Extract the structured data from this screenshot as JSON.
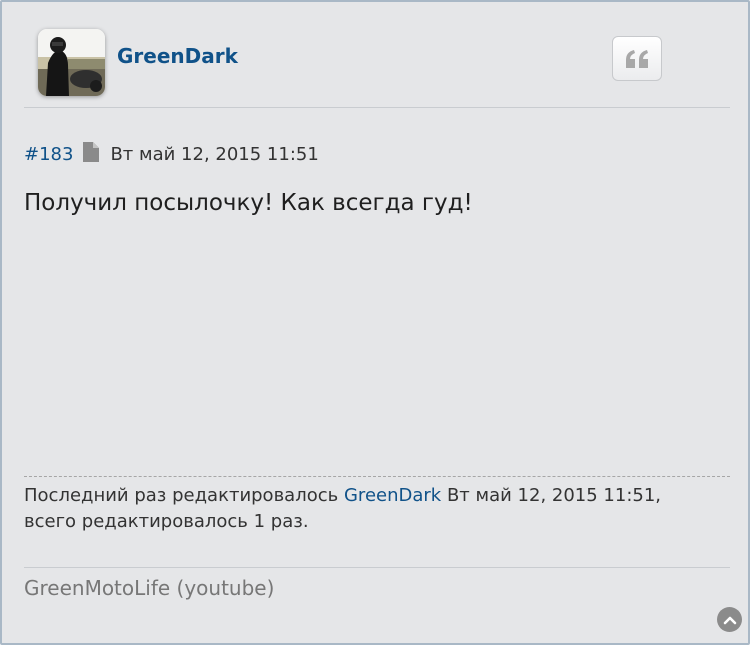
{
  "post": {
    "author": "GreenDark",
    "number": "#183",
    "date": "Вт май 12, 2015 11:51",
    "content": "Получил посылочку! Как всегда гуд!",
    "edit_notice": {
      "prefix": "Последний раз редактировалось",
      "user": "GreenDark",
      "date_suffix": "Вт май 12, 2015 11:51,",
      "count_text": "всего редактировалось 1 раз."
    },
    "signature": "GreenMotoLife (youtube)"
  },
  "icons": {
    "quote": "quote-icon",
    "post_link": "document-icon",
    "back_to_top": "chevron-up-circle-icon"
  },
  "colors": {
    "panel_bg": "#e5e6e8",
    "border": "#a9b8c6",
    "link": "#105289",
    "text": "#333333",
    "signature": "#777777"
  }
}
